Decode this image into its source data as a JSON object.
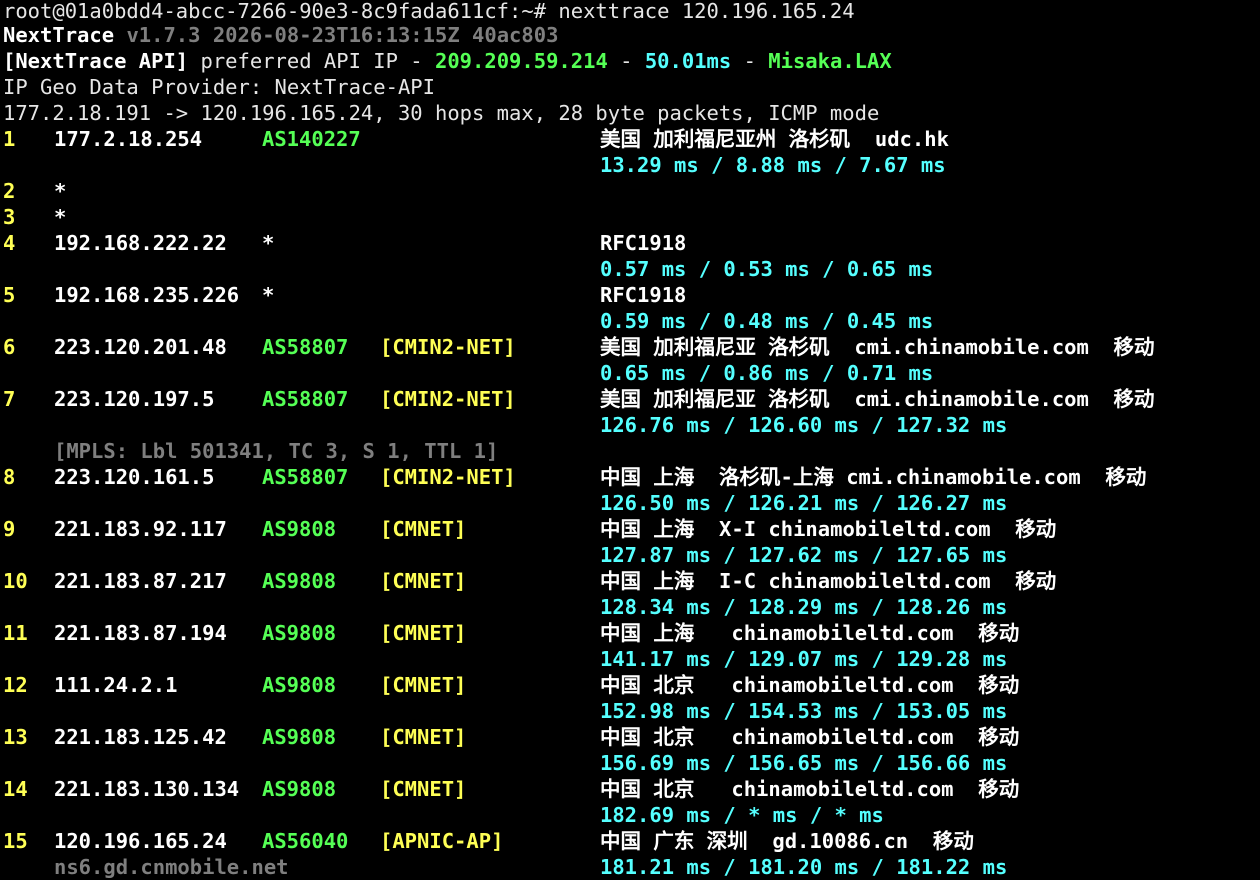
{
  "prompt": {
    "user_host": "root@01a0bdd4-abcc-7266-90e3-8c9fada611cf:~#",
    "command": "nexttrace 120.196.165.24"
  },
  "banner": {
    "name": "NextTrace",
    "version": "v1.7.3 2026-08-23T16:13:15Z 40ac803"
  },
  "api": {
    "tag": "[NextTrace API]",
    "label": "preferred API IP -",
    "ip": "209.209.59.214",
    "sep1": "-",
    "latency": "50.01ms",
    "sep2": "-",
    "node": "Misaka.LAX"
  },
  "geo_provider": "IP Geo Data Provider: NextTrace-API",
  "trace_summary": "177.2.18.191 -> 120.196.165.24, 30 hops max, 28 byte packets, ICMP mode",
  "hops": [
    {
      "hop": "1",
      "ip": "177.2.18.254",
      "asn": "AS140227",
      "net": "",
      "geo": "美国 加利福尼亚州 洛杉矶  udc.hk",
      "rtt": "13.29 ms / 8.88 ms / 7.67 ms"
    },
    {
      "hop": "2",
      "ip": "*"
    },
    {
      "hop": "3",
      "ip": "*"
    },
    {
      "hop": "4",
      "ip": "192.168.222.22",
      "asn": "*",
      "net": "",
      "geo": "RFC1918",
      "rtt": "0.57 ms / 0.53 ms / 0.65 ms"
    },
    {
      "hop": "5",
      "ip": "192.168.235.226",
      "asn": "*",
      "net": "",
      "geo": "RFC1918",
      "rtt": "0.59 ms / 0.48 ms / 0.45 ms"
    },
    {
      "hop": "6",
      "ip": "223.120.201.48",
      "asn": "AS58807",
      "net": "[CMIN2-NET]",
      "geo": "美国 加利福尼亚 洛杉矶  cmi.chinamobile.com  移动",
      "rtt": "0.65 ms / 0.86 ms / 0.71 ms"
    },
    {
      "hop": "7",
      "ip": "223.120.197.5",
      "asn": "AS58807",
      "net": "[CMIN2-NET]",
      "geo": "美国 加利福尼亚 洛杉矶  cmi.chinamobile.com  移动",
      "rtt": "126.76 ms / 126.60 ms / 127.32 ms",
      "mpls": "[MPLS: Lbl 501341, TC 3, S 1, TTL 1]"
    },
    {
      "hop": "8",
      "ip": "223.120.161.5",
      "asn": "AS58807",
      "net": "[CMIN2-NET]",
      "geo": "中国 上海  洛杉矶-上海 cmi.chinamobile.com  移动",
      "rtt": "126.50 ms / 126.21 ms / 126.27 ms"
    },
    {
      "hop": "9",
      "ip": "221.183.92.117",
      "asn": "AS9808",
      "net": "[CMNET]",
      "geo": "中国 上海  X-I chinamobileltd.com  移动",
      "rtt": "127.87 ms / 127.62 ms / 127.65 ms"
    },
    {
      "hop": "10",
      "ip": "221.183.87.217",
      "asn": "AS9808",
      "net": "[CMNET]",
      "geo": "中国 上海  I-C chinamobileltd.com  移动",
      "rtt": "128.34 ms / 128.29 ms / 128.26 ms"
    },
    {
      "hop": "11",
      "ip": "221.183.87.194",
      "asn": "AS9808",
      "net": "[CMNET]",
      "geo": "中国 上海   chinamobileltd.com  移动",
      "rtt": "141.17 ms / 129.07 ms / 129.28 ms"
    },
    {
      "hop": "12",
      "ip": "111.24.2.1",
      "asn": "AS9808",
      "net": "[CMNET]",
      "geo": "中国 北京   chinamobileltd.com  移动",
      "rtt": "152.98 ms / 154.53 ms / 153.05 ms"
    },
    {
      "hop": "13",
      "ip": "221.183.125.42",
      "asn": "AS9808",
      "net": "[CMNET]",
      "geo": "中国 北京   chinamobileltd.com  移动",
      "rtt": "156.69 ms / 156.65 ms / 156.66 ms"
    },
    {
      "hop": "14",
      "ip": "221.183.130.134",
      "asn": "AS9808",
      "net": "[CMNET]",
      "geo": "中国 北京   chinamobileltd.com  移动",
      "rtt": "182.69 ms / * ms / * ms"
    },
    {
      "hop": "15",
      "ip": "120.196.165.24",
      "asn": "AS56040",
      "net": "[APNIC-AP]",
      "geo": "中国 广东 深圳  gd.10086.cn  移动",
      "rtt": "181.21 ms / 181.20 ms / 181.22 ms",
      "rdns": "ns6.gd.cnmobile.net"
    }
  ],
  "colors": {
    "background": "#000000",
    "hop_number": "#ffff55",
    "asn": "#55ff55",
    "network_tag": "#ffff55",
    "rtt": "#55ffff",
    "dim": "#7f7f7f"
  }
}
